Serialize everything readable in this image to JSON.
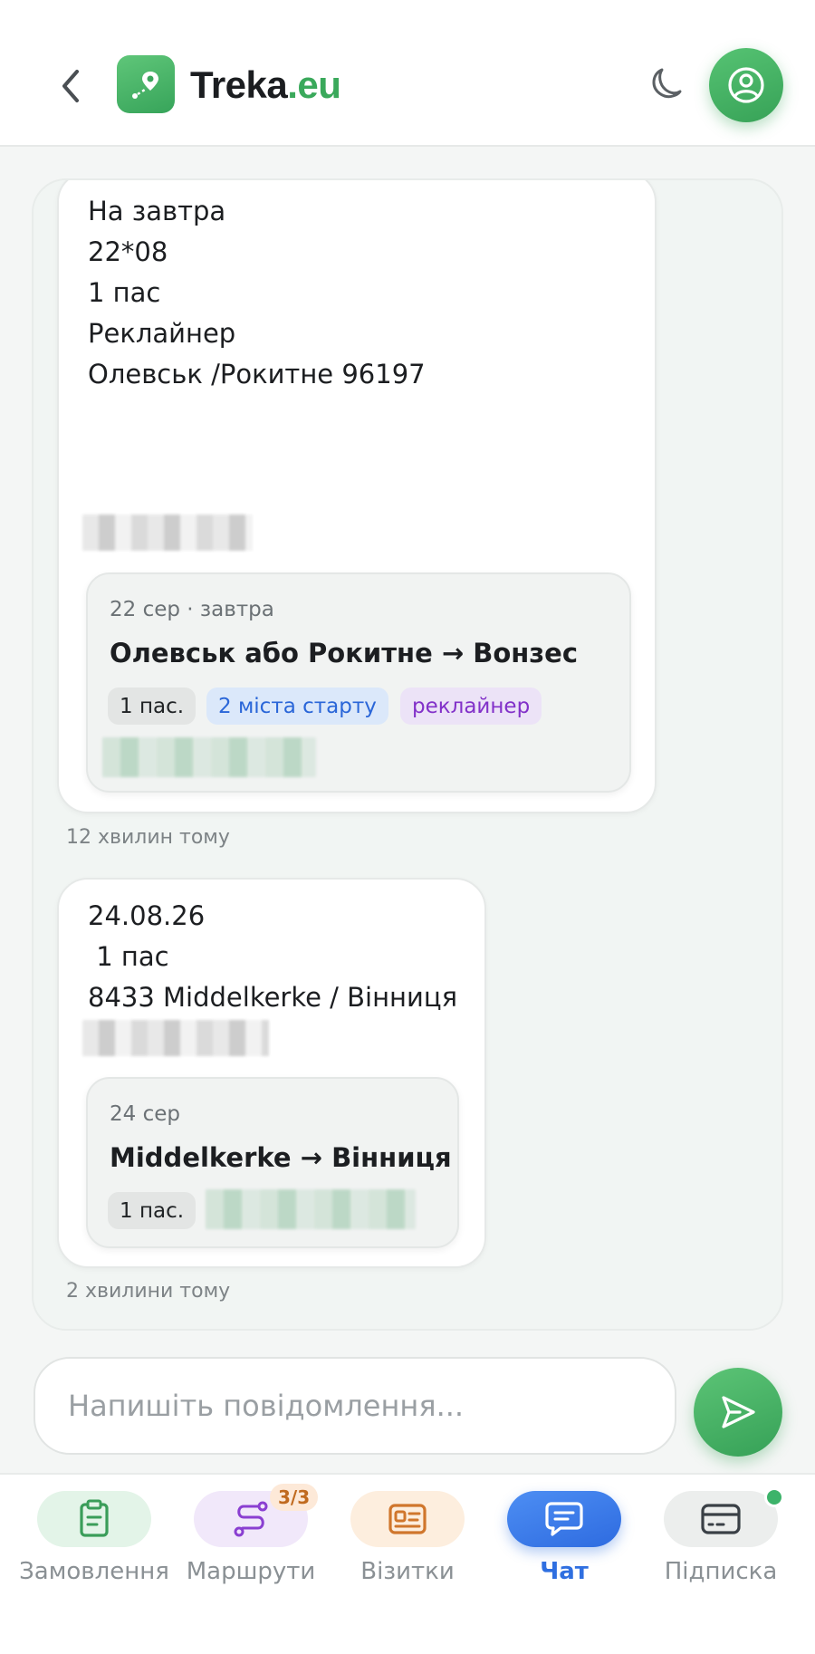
{
  "header": {
    "brand_main": "Treka",
    "brand_tld": ".eu"
  },
  "messages": [
    {
      "lines": [
        "На завтра",
        "22*08",
        "1 пас",
        "Реклайнер",
        "",
        "",
        "Олевськ /Рокитне 96197"
      ],
      "card": {
        "date": "22 сер · завтра",
        "route": "Олевськ або Рокитне → Вонзес",
        "chips": [
          "1 пас.",
          "2 міста старту",
          "реклайнер"
        ]
      },
      "time": "12 хвилин тому"
    },
    {
      "lines": [
        "24.08.26",
        " 1 пас",
        "8433 Middelkerke / Вінниця"
      ],
      "card": {
        "date": "24 сер",
        "route": "Middelkerke → Вінниця",
        "chips": [
          "1 пас."
        ]
      },
      "time": "2 хвилини тому"
    }
  ],
  "composer": {
    "placeholder": "Напишіть повідомлення..."
  },
  "nav": {
    "items": [
      {
        "label": "Замовлення",
        "icon": "clipboard-icon"
      },
      {
        "label": "Маршрути",
        "icon": "route-icon",
        "badge": "3/3"
      },
      {
        "label": "Візитки",
        "icon": "id-card-icon"
      },
      {
        "label": "Чат",
        "icon": "chat-icon"
      },
      {
        "label": "Підписка",
        "icon": "credit-card-icon"
      }
    ],
    "active_index": 3
  },
  "colors": {
    "brand_green": "#3aa95b",
    "active_blue": "#2f6fe0"
  }
}
